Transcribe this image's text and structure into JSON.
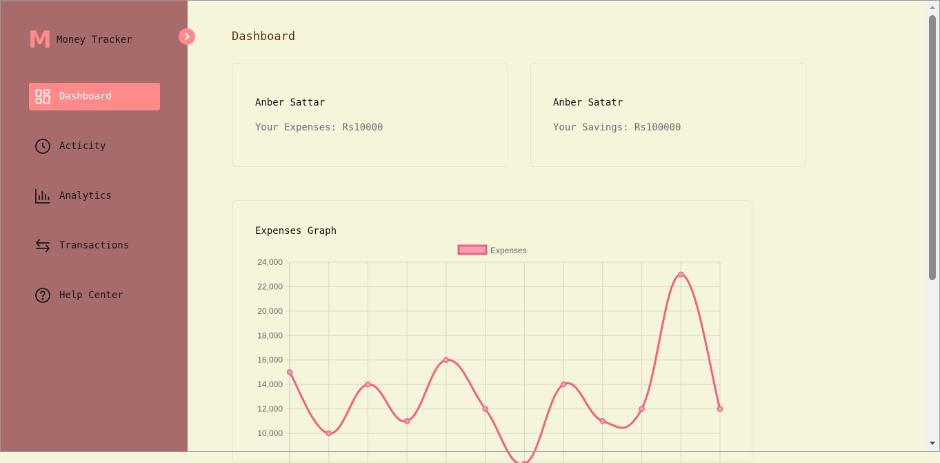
{
  "brand": {
    "logo": "M",
    "name": "Money Tracker"
  },
  "sidebar": {
    "items": [
      {
        "label": "Dashboard",
        "icon": "dashboard-grid-icon",
        "active": true
      },
      {
        "label": "Acticity",
        "icon": "clock-icon",
        "active": false
      },
      {
        "label": "Analytics",
        "icon": "bar-chart-icon",
        "active": false
      },
      {
        "label": "Transactions",
        "icon": "swap-arrows-icon",
        "active": false
      },
      {
        "label": "Help Center",
        "icon": "question-circle-icon",
        "active": false
      }
    ]
  },
  "main": {
    "title": "Dashboard",
    "cards": [
      {
        "name": "Anber Sattar",
        "detail": "Your Expenses: Rs10000"
      },
      {
        "name": "Anber Satatr",
        "detail": "Your Savings: Rs100000"
      }
    ],
    "graph_title": "Expenses Graph"
  },
  "colors": {
    "sidebar_bg": "#a76b6b",
    "accent": "#ff8a8a",
    "page_bg": "#f5f5dc",
    "line": "#f0627e"
  },
  "chart_data": {
    "type": "line",
    "x": [
      "",
      "",
      "",
      "",
      "",
      "",
      "",
      "",
      "",
      "",
      "",
      ""
    ],
    "series": [
      {
        "name": "Expenses",
        "values": [
          15000,
          10000,
          14000,
          11000,
          16000,
          12000,
          7500,
          14000,
          11000,
          12000,
          23000,
          12000
        ]
      }
    ],
    "ylim": [
      10000,
      24000
    ],
    "yticks": [
      "24,000",
      "22,000",
      "20,000",
      "18,000",
      "16,000",
      "14,000",
      "12,000",
      "10,000"
    ],
    "legend": "top-center",
    "grid": true,
    "smooth": true
  }
}
